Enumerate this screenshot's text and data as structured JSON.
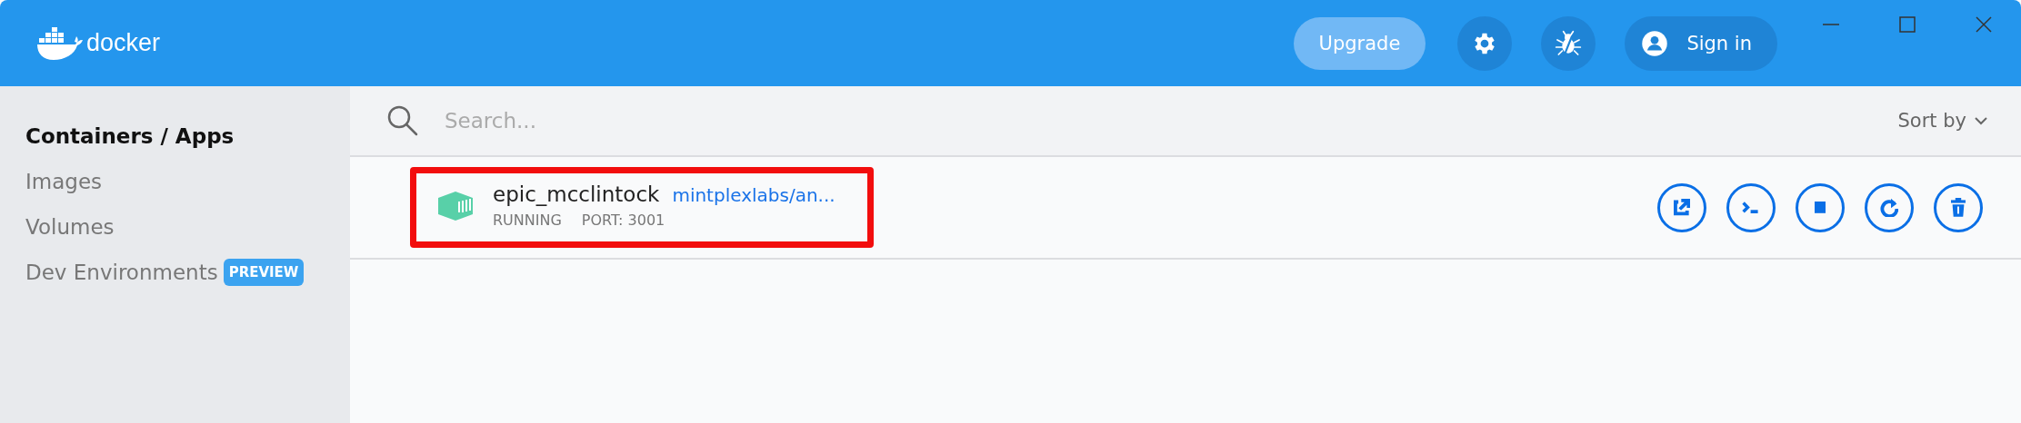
{
  "header": {
    "logo": "docker",
    "upgrade": "Upgrade",
    "sign_in": "Sign in"
  },
  "sidebar": {
    "items": [
      {
        "label": "Containers / Apps",
        "selected": true
      },
      {
        "label": "Images",
        "selected": false
      },
      {
        "label": "Volumes",
        "selected": false
      },
      {
        "label": "Dev Environments",
        "selected": false,
        "badge": "PREVIEW"
      }
    ]
  },
  "search": {
    "placeholder": "Search...",
    "sort": "Sort by"
  },
  "containers": [
    {
      "name": "epic_mcclintock",
      "image": "mintplexlabs/an...",
      "status": "RUNNING",
      "port": "PORT: 3001",
      "highlighted": true,
      "actions": [
        {
          "kind": "open"
        },
        {
          "kind": "cli"
        },
        {
          "kind": "stop"
        },
        {
          "kind": "restart"
        },
        {
          "kind": "delete"
        }
      ]
    }
  ]
}
